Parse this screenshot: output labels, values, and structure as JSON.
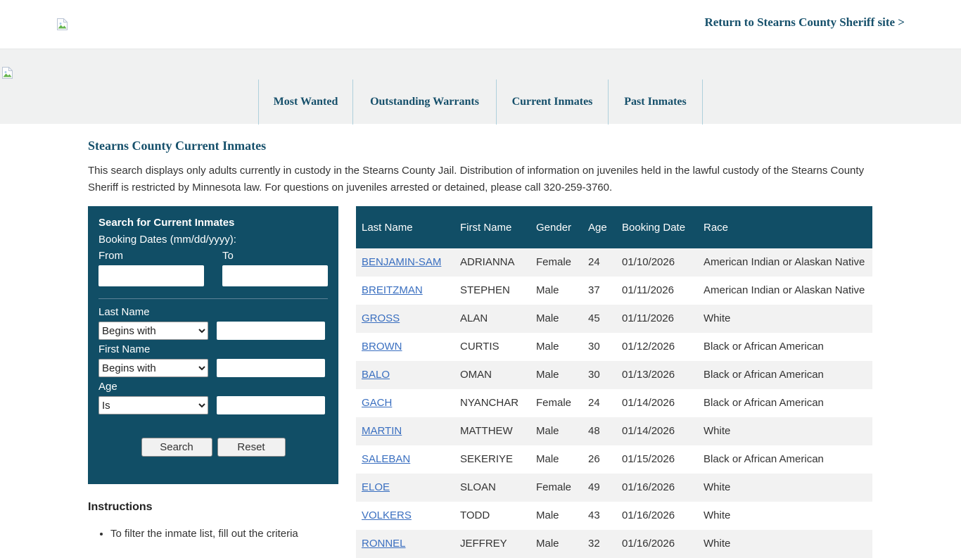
{
  "header": {
    "return_link": "Return to Stearns County Sheriff site >"
  },
  "nav": {
    "tabs": [
      {
        "label": "Most Wanted"
      },
      {
        "label": "Outstanding Warrants"
      },
      {
        "label": "Current Inmates"
      },
      {
        "label": "Past Inmates"
      }
    ]
  },
  "page": {
    "title": "Stearns County Current Inmates",
    "description": "This search displays only adults currently in custody in the Stearns County Jail. Distribution of information on juveniles held in the lawful custody of the Stearns County Sheriff is restricted by Minnesota law. For questions on juveniles arrested or detained, please call 320-259-3760."
  },
  "search_panel": {
    "title": "Search for Current Inmates",
    "booking_dates_label": "Booking Dates (mm/dd/yyyy):",
    "from_label": "From",
    "from_value": "",
    "to_label": "To",
    "to_value": "",
    "last_name_label": "Last Name",
    "last_name_operator": "Begins with",
    "last_name_value": "",
    "first_name_label": "First Name",
    "first_name_operator": "Begins with",
    "first_name_value": "",
    "age_label": "Age",
    "age_operator": "Is",
    "age_value": "",
    "search_button": "Search",
    "reset_button": "Reset"
  },
  "instructions": {
    "title": "Instructions",
    "items": [
      "To filter the inmate list, fill out the criteria"
    ]
  },
  "table": {
    "columns": [
      "Last Name",
      "First Name",
      "Gender",
      "Age",
      "Booking Date",
      "Race"
    ],
    "rows": [
      {
        "last_name": "BENJAMIN-SAM",
        "first_name": "ADRIANNA",
        "gender": "Female",
        "age": "24",
        "booking_date": "01/10/2026",
        "race": "American Indian or Alaskan Native"
      },
      {
        "last_name": "BREITZMAN",
        "first_name": "STEPHEN",
        "gender": "Male",
        "age": "37",
        "booking_date": "01/11/2026",
        "race": "American Indian or Alaskan Native"
      },
      {
        "last_name": "GROSS",
        "first_name": "ALAN",
        "gender": "Male",
        "age": "45",
        "booking_date": "01/11/2026",
        "race": "White"
      },
      {
        "last_name": "BROWN",
        "first_name": "CURTIS",
        "gender": "Male",
        "age": "30",
        "booking_date": "01/12/2026",
        "race": "Black or African American"
      },
      {
        "last_name": "BALO",
        "first_name": "OMAN",
        "gender": "Male",
        "age": "30",
        "booking_date": "01/13/2026",
        "race": "Black or African American"
      },
      {
        "last_name": "GACH",
        "first_name": "NYANCHAR",
        "gender": "Female",
        "age": "24",
        "booking_date": "01/14/2026",
        "race": "Black or African American"
      },
      {
        "last_name": "MARTIN",
        "first_name": "MATTHEW",
        "gender": "Male",
        "age": "48",
        "booking_date": "01/14/2026",
        "race": "White"
      },
      {
        "last_name": "SALEBAN",
        "first_name": "SEKERIYE",
        "gender": "Male",
        "age": "26",
        "booking_date": "01/15/2026",
        "race": "Black or African American"
      },
      {
        "last_name": "ELOE",
        "first_name": "SLOAN",
        "gender": "Female",
        "age": "49",
        "booking_date": "01/16/2026",
        "race": "White"
      },
      {
        "last_name": "VOLKERS",
        "first_name": "TODD",
        "gender": "Male",
        "age": "43",
        "booking_date": "01/16/2026",
        "race": "White"
      },
      {
        "last_name": "RONNEL",
        "first_name": "JEFFREY",
        "gender": "Male",
        "age": "32",
        "booking_date": "01/16/2026",
        "race": "White"
      }
    ]
  },
  "colors": {
    "panel_teal": "#114e66",
    "heading_teal": "#16506b",
    "nav_band_gray": "#f0f1f1",
    "nav_separator_blue": "#aed0dc",
    "alt_row_gray": "#f2f2f2",
    "link_blue": "#3a6fc0",
    "body_text": "#333333"
  }
}
